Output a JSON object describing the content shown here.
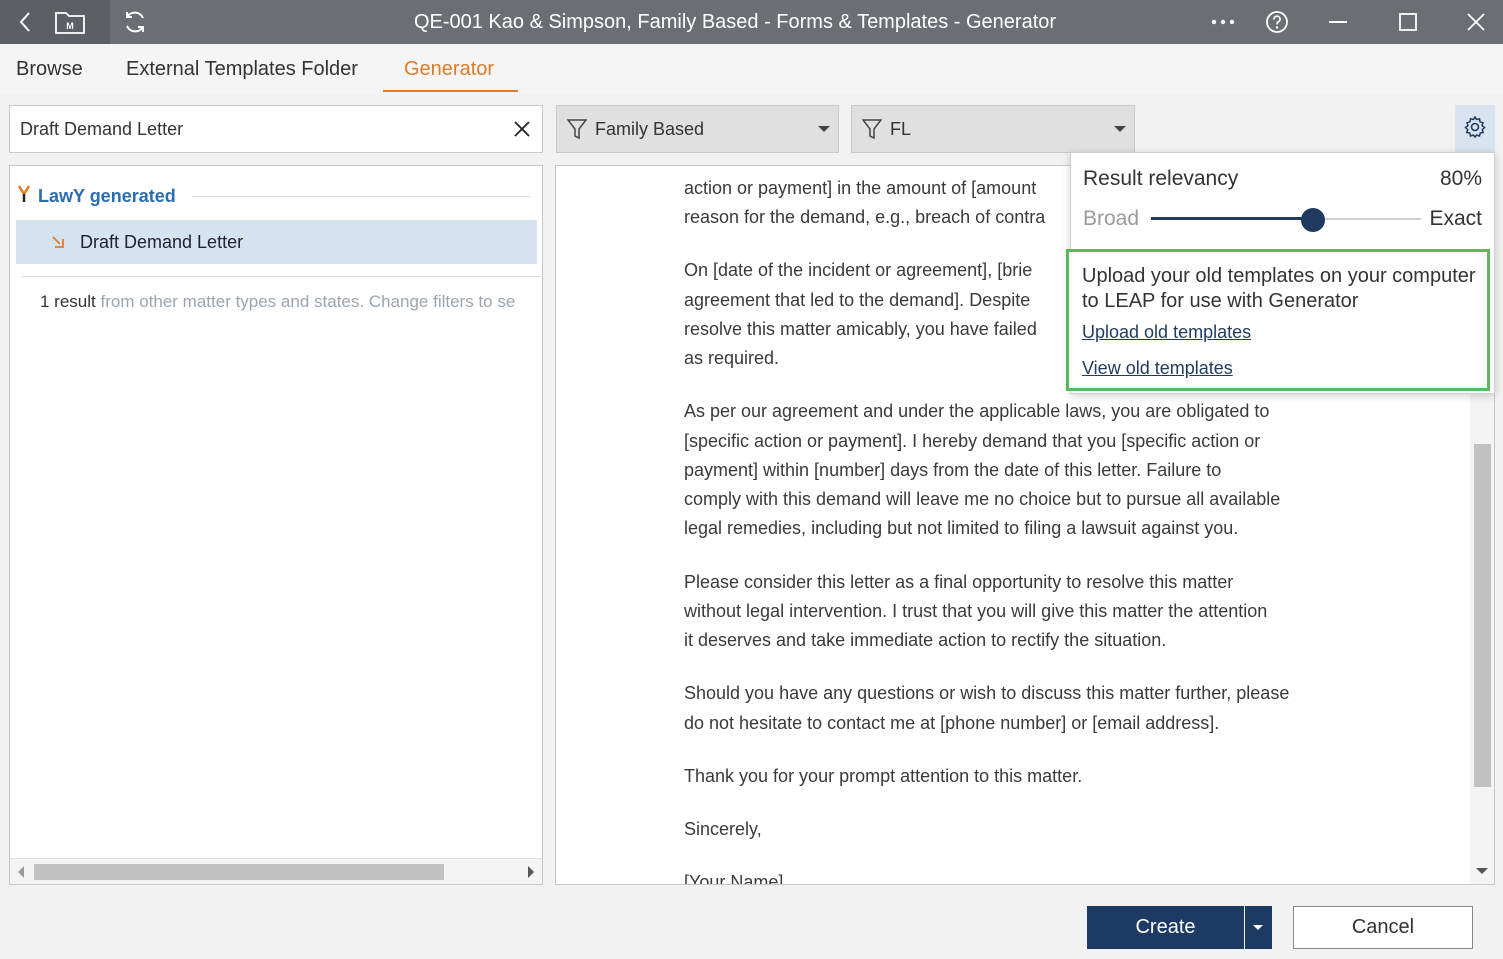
{
  "window": {
    "title": "QE-001 Kao & Simpson, Family Based - Forms & Templates - Generator",
    "colors": {
      "titlebar": "#6b6e73",
      "accent": "#e07b2a",
      "primary": "#1c3a63",
      "highlight": "#5cb85c"
    }
  },
  "tabs": [
    {
      "label": "Browse"
    },
    {
      "label": "External Templates Folder"
    },
    {
      "label": "Generator",
      "active": true
    }
  ],
  "search": {
    "value": "Draft Demand Letter"
  },
  "filters": {
    "matter_type": "Family Based",
    "state": "FL"
  },
  "results": {
    "group_label": "LawY generated",
    "items": [
      {
        "label": "Draft Demand Letter"
      }
    ],
    "count_text": "1 result",
    "hint_text": "from other matter types and states. Change filters to se"
  },
  "document": {
    "paragraphs": [
      "action or payment] in the amount of [amount",
      "reason for the demand, e.g., breach of contra",
      "On [date of the incident or agreement], [brie",
      "agreement that led to the demand]. Despite",
      "resolve this matter amicably, you have failed",
      "as required.",
      "As per our agreement and under the applicable laws, you are obligated to",
      "[specific action or payment]. I hereby demand that you [specific action or",
      "payment] within [number] days from the date of this letter. Failure to",
      "comply with this demand will leave me no choice but to pursue all available",
      "legal remedies, including but not limited to filing a lawsuit against you.",
      "Please consider this letter as a final opportunity to resolve this matter",
      "without legal intervention. I trust that you will give this matter the attention",
      "it deserves and take immediate action to rectify the situation.",
      "Should you have any questions or wish to discuss this matter further, please",
      "do not hesitate to contact me at [phone number] or [email address].",
      "Thank you for your prompt attention to this matter.",
      "Sincerely,",
      "[Your Name]"
    ]
  },
  "relevancy_popover": {
    "title": "Result relevancy",
    "value_text": "80%",
    "value": 0.8,
    "min_label": "Broad",
    "max_label": "Exact",
    "upload_text": "Upload your old templates on your computer to LEAP for use with Generator",
    "upload_link": "Upload old templates",
    "view_link": "View old templates"
  },
  "footer": {
    "create_label": "Create",
    "cancel_label": "Cancel"
  }
}
